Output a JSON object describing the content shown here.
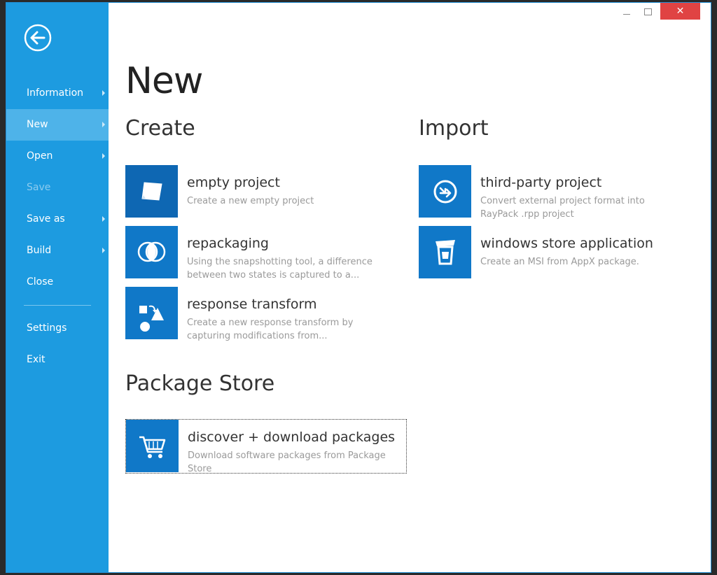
{
  "window": {
    "controls": {
      "minimize": "",
      "maximize": "",
      "close": "✕"
    },
    "accent_color": "#1d9be0",
    "tile_color": "#1078c8",
    "close_color": "#e04343"
  },
  "sidebar": {
    "back_icon": "back-arrow-icon",
    "items": [
      {
        "label": "Information",
        "has_submenu": true
      },
      {
        "label": "New",
        "has_submenu": true,
        "active": true
      },
      {
        "label": "Open",
        "has_submenu": true
      },
      {
        "label": "Save",
        "disabled": true
      },
      {
        "label": "Save as",
        "has_submenu": true
      },
      {
        "label": "Build",
        "has_submenu": true
      },
      {
        "label": "Close"
      },
      {
        "label": "Settings"
      },
      {
        "label": "Exit"
      }
    ]
  },
  "main": {
    "title": "New",
    "create": {
      "heading": "Create",
      "tiles": [
        {
          "title": "empty project",
          "description": "Create a new empty project",
          "icon": "sticky-note-icon"
        },
        {
          "title": "repackaging",
          "description": "Using the snapshotting tool, a difference between two states is captured to a...",
          "icon": "overlapping-circles-icon"
        },
        {
          "title": "response transform",
          "description": "Create a new response transform by capturing modifications from...",
          "icon": "shapes-transform-icon"
        }
      ]
    },
    "import": {
      "heading": "Import",
      "tiles": [
        {
          "title": "third-party project",
          "description": "Convert external project format into RayPack .rpp project",
          "icon": "circle-arrow-import-icon"
        },
        {
          "title": "windows store application",
          "description": "Create an MSI from AppX package.",
          "icon": "store-bag-icon"
        }
      ]
    },
    "package_store": {
      "heading": "Package Store",
      "tiles": [
        {
          "title": "discover + download packages",
          "description": "Download software packages from Package Store",
          "icon": "shopping-cart-icon"
        }
      ]
    }
  }
}
